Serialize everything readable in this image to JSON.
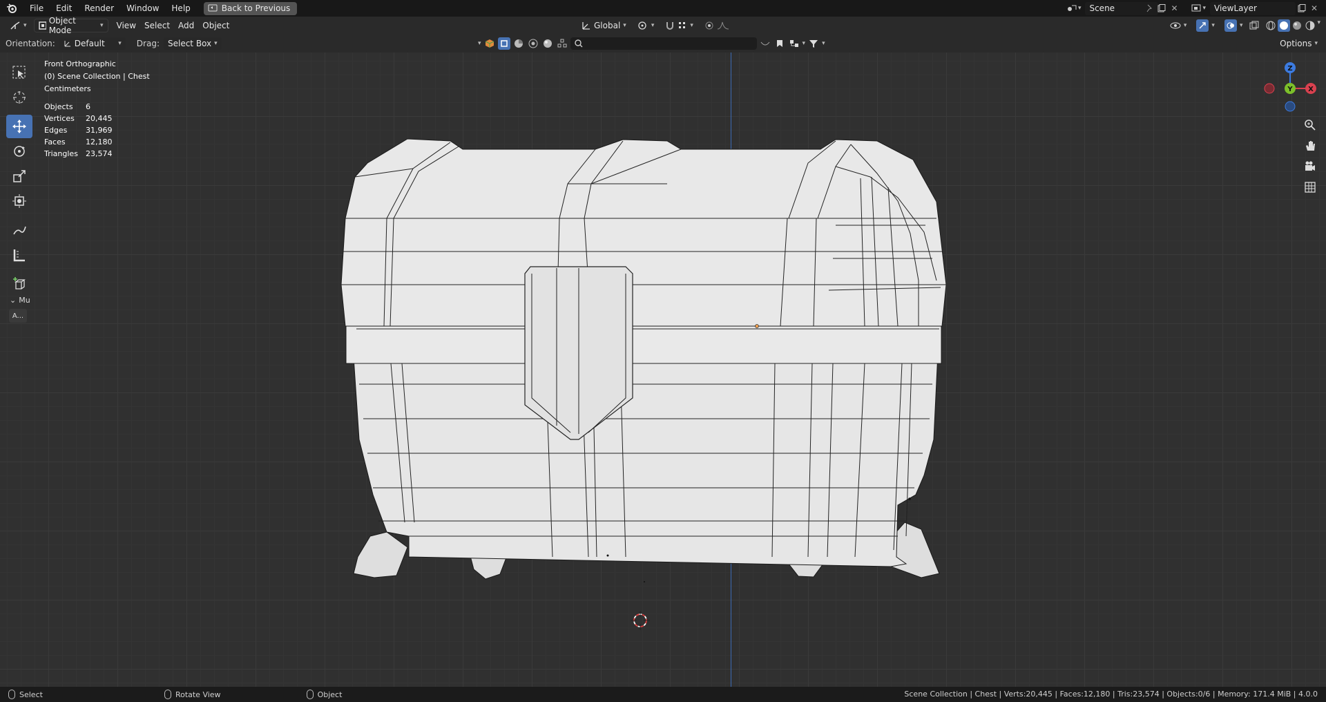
{
  "menu": {
    "items": [
      "File",
      "Edit",
      "Render",
      "Window",
      "Help"
    ],
    "back_button": "Back to Previous"
  },
  "scene": {
    "name": "Scene",
    "view_layer": "ViewLayer"
  },
  "header": {
    "mode": "Object Mode",
    "view": "View",
    "select": "Select",
    "add": "Add",
    "object": "Object",
    "transform_orientation": "Global",
    "options": "Options"
  },
  "tool_settings": {
    "orientation_label": "Orientation:",
    "orientation_value": "Default",
    "drag_label": "Drag:",
    "drag_value": "Select Box"
  },
  "viewport": {
    "view_name": "Front Orthographic",
    "collection": "(0) Scene Collection | Chest",
    "units": "Centimeters",
    "stats": [
      {
        "label": "Objects",
        "value": "6"
      },
      {
        "label": "Vertices",
        "value": "20,445"
      },
      {
        "label": "Edges",
        "value": "31,969"
      },
      {
        "label": "Faces",
        "value": "12,180"
      },
      {
        "label": "Triangles",
        "value": "23,574"
      }
    ],
    "panel_collapse": "Mu",
    "panel_button": "A..."
  },
  "gizmo": {
    "z": "Z",
    "y": "Y",
    "x": "X"
  },
  "statusbar": {
    "left_action": "Select",
    "middle_action": "Rotate View",
    "right_action": "Object",
    "info": "Scene Collection | Chest | Verts:20,445 | Faces:12,180 | Tris:23,574 | Objects:0/6 | Memory: 171.4 MiB | 4.0.0"
  },
  "colors": {
    "accent": "#4772b3",
    "x_axis": "#d9414f",
    "y_axis": "#7cbf2a",
    "z_axis": "#3c7be0"
  }
}
